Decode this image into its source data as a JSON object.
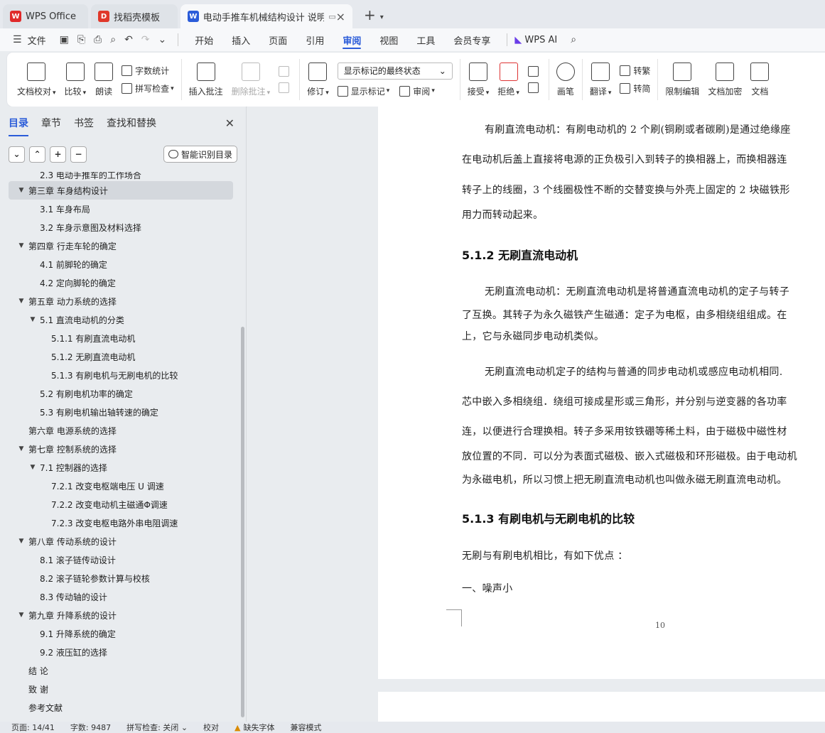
{
  "tabs": [
    {
      "label": "WPS Office",
      "logo_color": "#e02a2a",
      "logo": "W"
    },
    {
      "label": "找稻壳模板",
      "logo_color": "#e0382a",
      "logo": "D"
    },
    {
      "label": "电动手推车机械结构设计 说明",
      "logo_color": "#2b5cd9",
      "logo": "W"
    }
  ],
  "menubar": {
    "file": "文件",
    "items": [
      "开始",
      "插入",
      "页面",
      "引用",
      "审阅",
      "视图",
      "工具",
      "会员专享"
    ],
    "active": "审阅",
    "wps_ai": "WPS AI"
  },
  "ribbon": {
    "doc_check": "文档校对",
    "compare": "比较",
    "read_aloud": "朗读",
    "word_count": "字数统计",
    "spell_check": "拼写检查",
    "insert_comment": "插入批注",
    "delete_comment": "删除批注",
    "revise": "修订",
    "markup_select": "显示标记的最终状态",
    "show_markup": "显示标记",
    "review": "审阅",
    "accept": "接受",
    "reject": "拒绝",
    "pen": "画笔",
    "translate": "翻译",
    "to_traditional": "转繁",
    "to_simplified": "转简",
    "restrict_edit": "限制编辑",
    "doc_encrypt": "文档加密",
    "doc_more": "文档"
  },
  "nav": {
    "tabs": [
      "目录",
      "章节",
      "书签",
      "查找和替换"
    ],
    "smart_toc": "智能识别目录",
    "toc": [
      {
        "label": "2.3 电动手推车的工作场合",
        "indent": 2,
        "caret": ""
      },
      {
        "label": "第三章  车身结构设计",
        "indent": 1,
        "caret": "▼",
        "selected": true
      },
      {
        "label": "3.1 车身布局",
        "indent": 2,
        "caret": ""
      },
      {
        "label": "3.2  车身示意图及材料选择",
        "indent": 2,
        "caret": ""
      },
      {
        "label": "第四章  行走车轮的确定",
        "indent": 1,
        "caret": "▼"
      },
      {
        "label": "4.1    前脚轮的确定",
        "indent": 2,
        "caret": ""
      },
      {
        "label": "4.2  定向脚轮的确定",
        "indent": 2,
        "caret": ""
      },
      {
        "label": "第五章  动力系统的选择",
        "indent": 1,
        "caret": "▼"
      },
      {
        "label": "5.1  直流电动机的分类",
        "indent": 2,
        "caret": "▼"
      },
      {
        "label": "5.1.1  有刷直流电动机",
        "indent": 3,
        "caret": ""
      },
      {
        "label": "5.1.2  无刷直流电动机",
        "indent": 3,
        "caret": ""
      },
      {
        "label": "5.1.3  有刷电机与无刷电机的比较",
        "indent": 3,
        "caret": ""
      },
      {
        "label": "5.2    有刷电机功率的确定",
        "indent": 2,
        "caret": ""
      },
      {
        "label": "5.3    有刷电机输出轴转速的确定",
        "indent": 2,
        "caret": ""
      },
      {
        "label": "第六章  电源系统的选择",
        "indent": 1,
        "caret": ""
      },
      {
        "label": "第七章  控制系统的选择",
        "indent": 1,
        "caret": "▼"
      },
      {
        "label": "7.1    控制器的选择",
        "indent": 2,
        "caret": "▼"
      },
      {
        "label": "7.2.1    改变电枢端电压 U 调速",
        "indent": 3,
        "caret": ""
      },
      {
        "label": "7.2.2    改变电动机主磁通Φ调速",
        "indent": 3,
        "caret": ""
      },
      {
        "label": "7.2.3    改变电枢电路外串电阻调速",
        "indent": 3,
        "caret": ""
      },
      {
        "label": "第八章    传动系统的设计",
        "indent": 1,
        "caret": "▼"
      },
      {
        "label": "8.1  滚子链传动设计",
        "indent": 2,
        "caret": ""
      },
      {
        "label": "8.2    滚子链轮参数计算与校核",
        "indent": 2,
        "caret": ""
      },
      {
        "label": "8.3  传动轴的设计",
        "indent": 2,
        "caret": ""
      },
      {
        "label": "第九章  升降系统的设计",
        "indent": 1,
        "caret": "▼"
      },
      {
        "label": "9.1    升降系统的确定",
        "indent": 2,
        "caret": ""
      },
      {
        "label": "9.2    液压缸的选择",
        "indent": 2,
        "caret": ""
      },
      {
        "label": "结    论",
        "indent": 1,
        "caret": ""
      },
      {
        "label": "致    谢",
        "indent": 1,
        "caret": ""
      },
      {
        "label": "参考文献",
        "indent": 1,
        "caret": ""
      }
    ]
  },
  "document": {
    "lines": [
      "有刷直流电动机：有刷电动机的 2 个刷(铜刷或者碳刷)是通过绝缘座",
      "在电动机后盖上直接将电源的正负极引入到转子的换相器上，而换相器连",
      "转子上的线圈，3 个线圈极性不断的交替变换与外壳上固定的 2 块磁铁形",
      "用力而转动起来。",
      "5.1.2  无刷直流电动机",
      "无刷直流电动机：无刷直流电动机是将普通直流电动机的定子与转子",
      "了互换。其转子为永久磁铁产生磁通：定子为电枢，由多相绕组组成。在",
      "上，它与永磁同步电动机类似。",
      "无刷直流电动机定子的结构与普通的同步电动机或感应电动机相同.",
      "芯中嵌入多相绕组．绕组可接成星形或三角形，并分别与逆变器的各功率",
      "连，以便进行合理换相。转子多采用钕铁硼等稀土料，由于磁极中磁性材",
      "放位置的不同．可以分为表面式磁极、嵌入式磁极和环形磁极。由于电动机",
      "为永磁电机，所以习惯上把无刷直流电动机也叫做永磁无刷直流电动机。",
      "5.1.3  有刷电机与无刷电机的比较",
      "无刷与有刷电机相比，有如下优点 ：",
      "一、噪声小"
    ],
    "page_number": "10"
  },
  "status": {
    "page": "页面: 14/41",
    "words": "字数: 9487",
    "spell": "拼写检查: 关闭",
    "proof": "校对",
    "missing_font": "缺失字体",
    "compat": "兼容模式"
  }
}
